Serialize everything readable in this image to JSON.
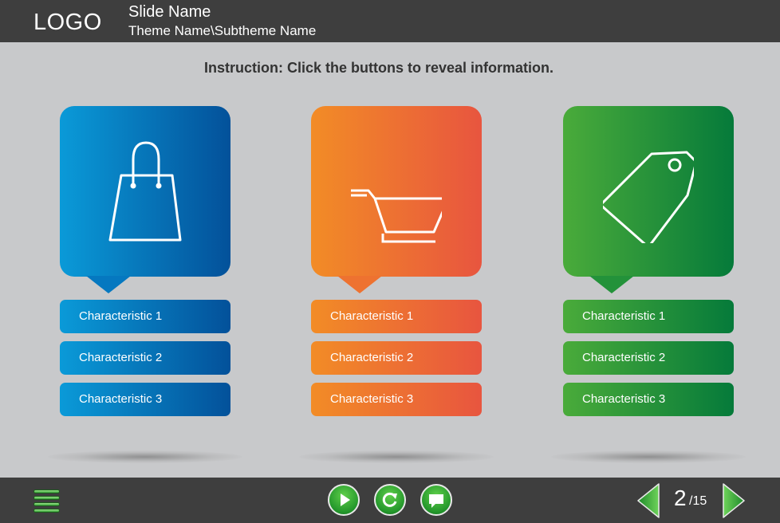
{
  "header": {
    "logo": "LOGO",
    "slide_name": "Slide Name",
    "theme_name": "Theme Name\\Subtheme Name"
  },
  "instruction": "Instruction: Click the buttons to reveal information.",
  "cards": [
    {
      "icon": "shopping-bag-icon",
      "color_start": "#0a9ad8",
      "color_end": "#03519a",
      "characteristics": [
        "Characteristic 1",
        "Characteristic 2",
        "Characteristic 3"
      ]
    },
    {
      "icon": "shopping-cart-icon",
      "color_start": "#f28c26",
      "color_end": "#e8553f",
      "characteristics": [
        "Characteristic 1",
        "Characteristic 2",
        "Characteristic 3"
      ]
    },
    {
      "icon": "price-tag-icon",
      "color_start": "#4aab3a",
      "color_end": "#057a3a",
      "characteristics": [
        "Characteristic 1",
        "Characteristic 2",
        "Characteristic 3"
      ]
    }
  ],
  "footer": {
    "menu_icon": "hamburger-menu-icon",
    "controls": [
      "play-icon",
      "replay-icon",
      "comment-icon"
    ],
    "page_current": "2",
    "page_total": "/15"
  }
}
